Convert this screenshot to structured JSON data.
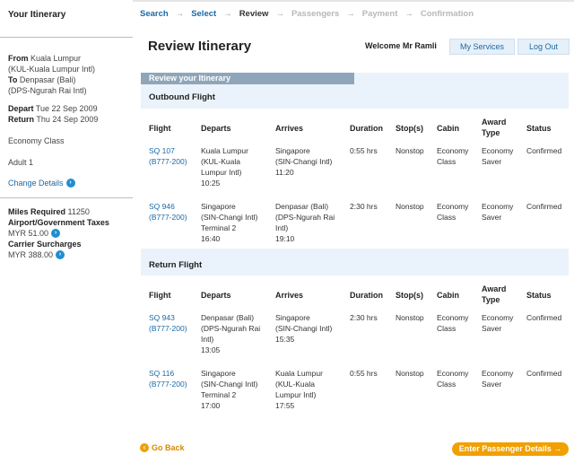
{
  "sidebar": {
    "title": "Your Itinerary",
    "from_label": "From",
    "from_city": "Kuala Lumpur",
    "from_code": "(KUL-Kuala Lumpur Intl)",
    "to_label": "To",
    "to_city": "Denpasar (Bali)",
    "to_code": "(DPS-Ngurah Rai Intl)",
    "depart_label": "Depart",
    "depart_date": "Tue 22 Sep 2009",
    "return_label": "Return",
    "return_date": "Thu 24 Sep 2009",
    "cabin": "Economy Class",
    "passengers": "Adult 1",
    "change_details": "Change Details",
    "miles_label": "Miles Required",
    "miles_value": "11250",
    "taxes_label": "Airport/Government Taxes",
    "taxes_value": "MYR  51.00",
    "surcharge_label": "Carrier Surcharges",
    "surcharge_value": "MYR  388.00"
  },
  "steps": [
    {
      "label": "Search"
    },
    {
      "label": "Select"
    },
    {
      "label": "Review"
    },
    {
      "label": "Passengers"
    },
    {
      "label": "Payment"
    },
    {
      "label": "Confirmation"
    }
  ],
  "header": {
    "title": "Review Itinerary",
    "welcome": "Welcome Mr  Ramli",
    "services_button": "My Services",
    "logout_button": "Log Out"
  },
  "panel": {
    "tab_label": "Review your Itinerary",
    "outbound_title": "Outbound Flight",
    "return_title": "Return Flight"
  },
  "columns": {
    "flight": "Flight",
    "departs": "Departs",
    "arrives": "Arrives",
    "duration": "Duration",
    "stops": "Stop(s)",
    "cabin": "Cabin",
    "award_type_1": "Award",
    "award_type_2": "Type",
    "status": "Status"
  },
  "outbound": [
    {
      "flight": "SQ  107",
      "aircraft": "(B777-200)",
      "dep1": "Kuala Lumpur",
      "dep2": "(KUL-Kuala",
      "dep3": "Lumpur Intl)",
      "dep4": "10:25",
      "arr1": "Singapore",
      "arr2": "(SIN-Changi Intl)",
      "arr3": "11:20",
      "arr4": "",
      "duration": "0:55 hrs",
      "stops": "Nonstop",
      "cabin1": "Economy",
      "cabin2": "Class",
      "award1": "Economy",
      "award2": "Saver",
      "status": "Confirmed"
    },
    {
      "flight": "SQ  946",
      "aircraft": "(B777-200)",
      "dep1": "Singapore",
      "dep2": "(SIN-Changi Intl)",
      "dep3": "Terminal   2",
      "dep4": "16:40",
      "arr1": "Denpasar (Bali)",
      "arr2": "(DPS-Ngurah Rai",
      "arr3": "Intl)",
      "arr4": "19:10",
      "duration": "2:30 hrs",
      "stops": "Nonstop",
      "cabin1": "Economy",
      "cabin2": "Class",
      "award1": "Economy",
      "award2": "Saver",
      "status": "Confirmed"
    }
  ],
  "return": [
    {
      "flight": "SQ  943",
      "aircraft": "(B777-200)",
      "dep1": "Denpasar (Bali)",
      "dep2": "(DPS-Ngurah Rai",
      "dep3": "Intl)",
      "dep4": "13:05",
      "arr1": "Singapore",
      "arr2": "(SIN-Changi Intl)",
      "arr3": "15:35",
      "arr4": "",
      "duration": "2:30 hrs",
      "stops": "Nonstop",
      "cabin1": "Economy",
      "cabin2": "Class",
      "award1": "Economy",
      "award2": "Saver",
      "status": "Confirmed"
    },
    {
      "flight": "SQ  116",
      "aircraft": "(B777-200)",
      "dep1": "Singapore",
      "dep2": "(SIN-Changi Intl)",
      "dep3": "Terminal   2",
      "dep4": "17:00",
      "arr1": "Kuala Lumpur",
      "arr2": "(KUL-Kuala",
      "arr3": "Lumpur Intl)",
      "arr4": "17:55",
      "duration": "0:55 hrs",
      "stops": "Nonstop",
      "cabin1": "Economy",
      "cabin2": "Class",
      "award1": "Economy",
      "award2": "Saver",
      "status": "Confirmed"
    }
  ],
  "footer": {
    "back": "Go Back",
    "next": "Enter Passenger Details"
  },
  "colors": {
    "link": "#1a6aa8",
    "accent": "#f0a000",
    "panel": "#eaf3fb",
    "tab": "#8fa6ba"
  },
  "icons": {
    "info": "info-circle-icon",
    "back": "back-arrow-icon",
    "next": "forward-arrow-icon"
  }
}
